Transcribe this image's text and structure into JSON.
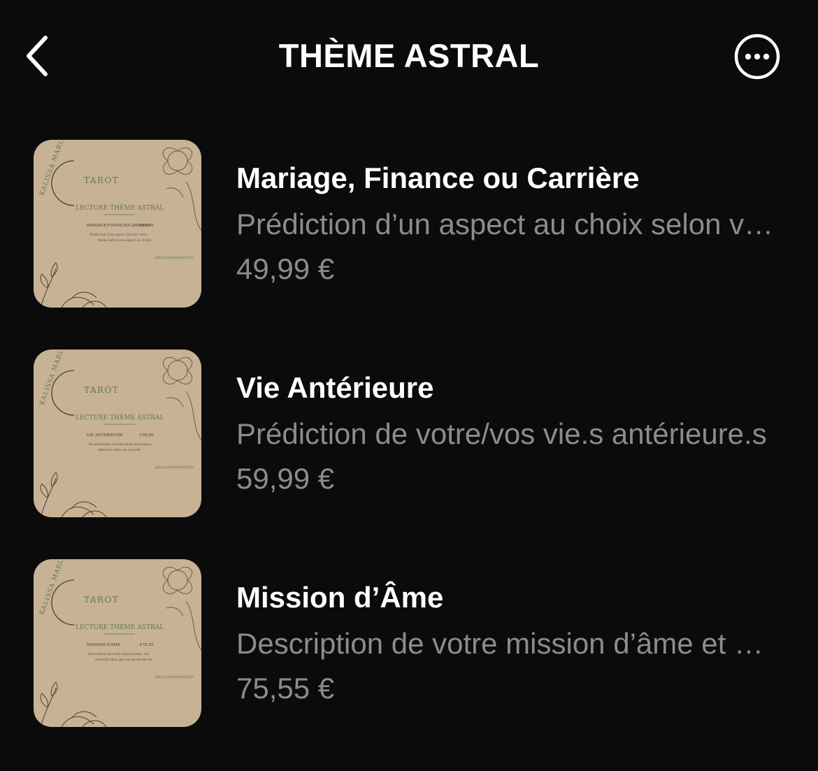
{
  "header": {
    "title": "THÈME ASTRAL"
  },
  "products": [
    {
      "name": "Mariage, Finance ou Carrière",
      "description": "Prédiction d’un aspect au choix selon votre thème astral",
      "price": "49,99 €",
      "thumb": {
        "brand": "KALISSA MARLENE",
        "tarot": "TAROT",
        "heading": "LECTURE THÈME ASTRAL",
        "line_item": "MARIAGE/FINANCE/CARRIERE",
        "line_price": "€49,99",
        "note1": "Prédiction d'un aspect tiré sur votre",
        "note2": "thème astral (un aspect au choix)",
        "handle": "@KALISSAMARLENE"
      }
    },
    {
      "name": "Vie Antérieure",
      "description": "Prédiction de votre/vos vie.s antérieure.s",
      "price": "59,99 €",
      "thumb": {
        "brand": "KALISSA MARLENE",
        "tarot": "TAROT",
        "heading": "LECTURE THÈME ASTRAL",
        "line_item": "VIE ANTERIEURE",
        "line_price": "€59,99",
        "note1": "Vie antérieure et indications karmiques",
        "note2": "affectant votre vie actuelle",
        "handle": "@KALISSAMARLENE"
      }
    },
    {
      "name": "Mission d’Âme",
      "description": "Description de votre mission d’âme et de vos objectifs",
      "price": "75,55 €",
      "thumb": {
        "brand": "KALISSA MARLENE",
        "tarot": "TAROT",
        "heading": "LECTURE THÈME ASTRAL",
        "line_item": "MISSION D'ÂME",
        "line_price": "€75,55",
        "note1": "Description de votre mission âme, vos",
        "note2": "objectifs ainsi que vos leçons de vie",
        "handle": "@KALISSAMARLENE"
      }
    }
  ],
  "colors": {
    "background": "#0b0b0c",
    "primary_text": "#ffffff",
    "secondary_text": "#8b8b90",
    "parchment": "#cdb89c",
    "ink_green": "#5d7a4c"
  },
  "icons": {
    "back": "chevron-left-icon",
    "more": "more-options-icon"
  }
}
